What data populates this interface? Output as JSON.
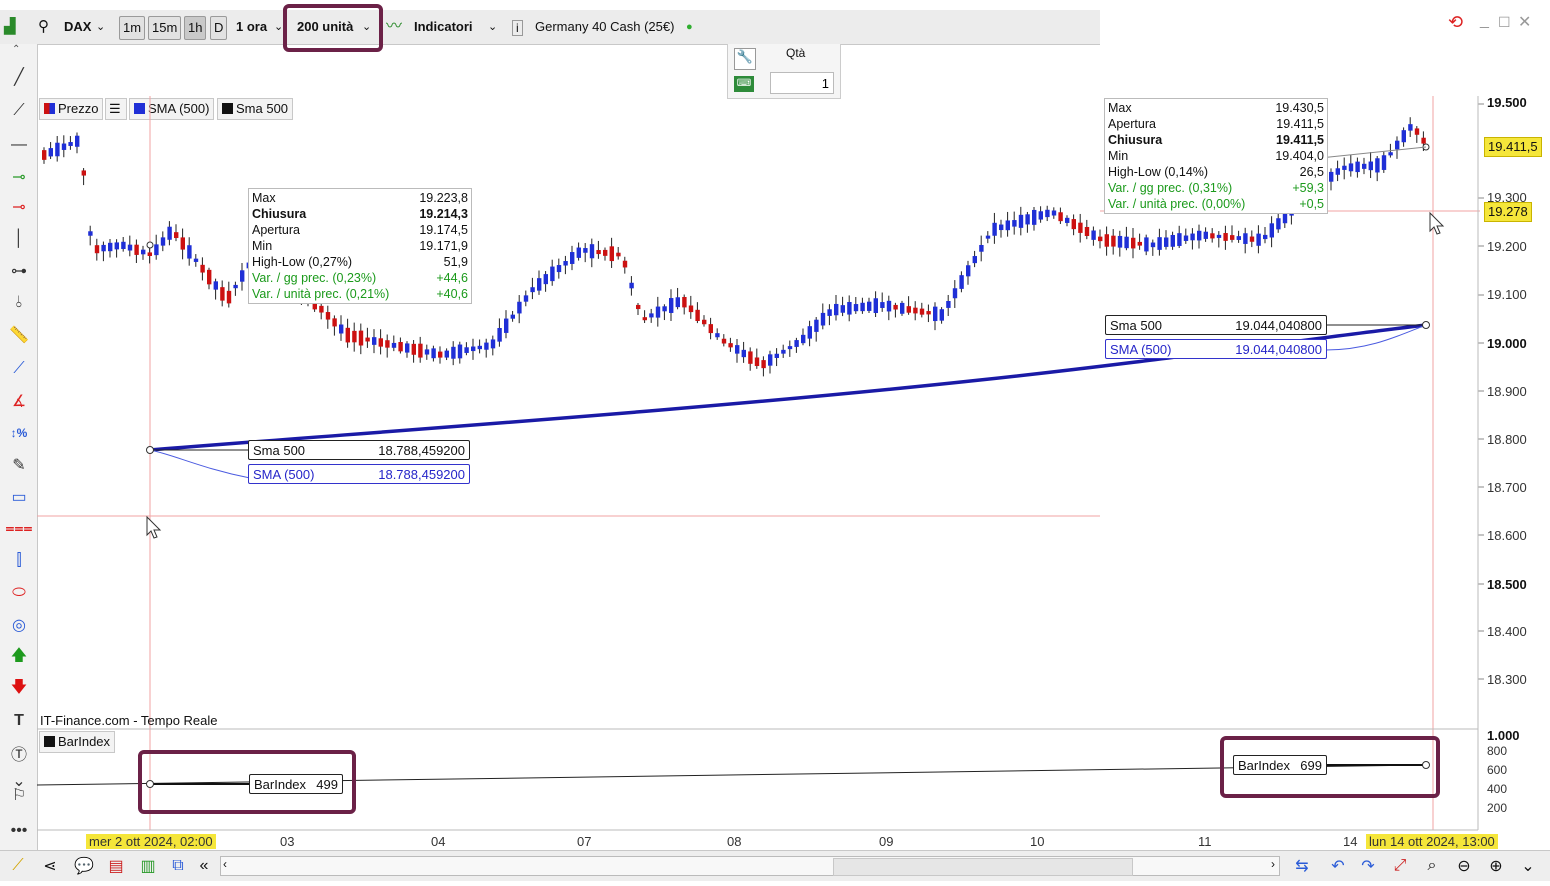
{
  "toolbar": {
    "symbol": "DAX",
    "timeframes": [
      "1m",
      "15m",
      "1h",
      "D"
    ],
    "period": "1 ora",
    "units": "200 unità",
    "indicators": "Indicatori",
    "instrument": "Germany 40 Cash (25€)"
  },
  "order": {
    "qty_label": "Qtà",
    "qty_value": "1"
  },
  "legend": {
    "price": "Prezzo",
    "sma_blue": "SMA (500)",
    "sma_black": "Sma 500"
  },
  "tooltip_left": {
    "rows": [
      {
        "k": "Max",
        "v": "19.223,8"
      },
      {
        "k": "Chiusura",
        "v": "19.214,3"
      },
      {
        "k": "Apertura",
        "v": "19.174,5"
      },
      {
        "k": "Min",
        "v": "19.171,9"
      },
      {
        "k": "High-Low (0,27%)",
        "v": "51,9"
      },
      {
        "k": "Var. / gg prec. (0,23%)",
        "v": "+44,6"
      },
      {
        "k": "Var. / unità prec. (0,21%)",
        "v": "+40,6"
      }
    ]
  },
  "tooltip_right": {
    "rows": [
      {
        "k": "Max",
        "v": "19.430,5"
      },
      {
        "k": "Apertura",
        "v": "19.411,5"
      },
      {
        "k": "Chiusura",
        "v": "19.411,5"
      },
      {
        "k": "Min",
        "v": "19.404,0"
      },
      {
        "k": "High-Low (0,14%)",
        "v": "26,5"
      },
      {
        "k": "Var. / gg prec. (0,31%)",
        "v": "+59,3"
      },
      {
        "k": "Var. / unità prec. (0,00%)",
        "v": "+0,5"
      }
    ]
  },
  "labels": {
    "left_sma_black": {
      "name": "Sma 500",
      "value": "18.788,459200"
    },
    "left_sma_blue": {
      "name": "SMA (500)",
      "value": "18.788,459200"
    },
    "right_sma_black": {
      "name": "Sma 500",
      "value": "19.044,040800"
    },
    "right_sma_blue": {
      "name": "SMA (500)",
      "value": "19.044,040800"
    },
    "bar_left": {
      "name": "BarIndex",
      "value": "499"
    },
    "bar_right": {
      "name": "BarIndex",
      "value": "699"
    }
  },
  "source": "IT-Finance.com - Tempo Reale",
  "barindex_legend": "BarIndex",
  "price_axis": [
    "19.500",
    "19.300",
    "19.200",
    "19.100",
    "19.000",
    "18.900",
    "18.800",
    "18.700",
    "18.600",
    "18.500",
    "18.400",
    "18.300"
  ],
  "price_tag_current": "19.411,5",
  "price_tag_cursor": "19.278",
  "bar_axis": [
    "1.000",
    "800",
    "600",
    "400",
    "200"
  ],
  "x_axis": {
    "start": "mer 2 ott 2024, 02:00",
    "ticks": [
      "03",
      "04",
      "07",
      "08",
      "09",
      "10",
      "11",
      "14"
    ],
    "end": "lun 14 ott 2024, 13:00"
  },
  "colors": {
    "up": "#1f2fd6",
    "down": "#cc1111",
    "sma": "#1a1aa6",
    "highlight": "#6b2147",
    "tag": "#f5e63a"
  },
  "chart_data": {
    "type": "line",
    "series": [
      {
        "name": "SMA (500)",
        "x": [
          "mer 2 ott 2024, 02:00",
          "lun 14 ott 2024, 13:00"
        ],
        "values": [
          18788.4592,
          19044.0408
        ]
      },
      {
        "name": "BarIndex",
        "x": [
          "mer 2 ott 2024, 02:00",
          "lun 14 ott 2024, 13:00"
        ],
        "values": [
          499,
          699
        ]
      }
    ],
    "ylim": [
      18250,
      19520
    ]
  }
}
